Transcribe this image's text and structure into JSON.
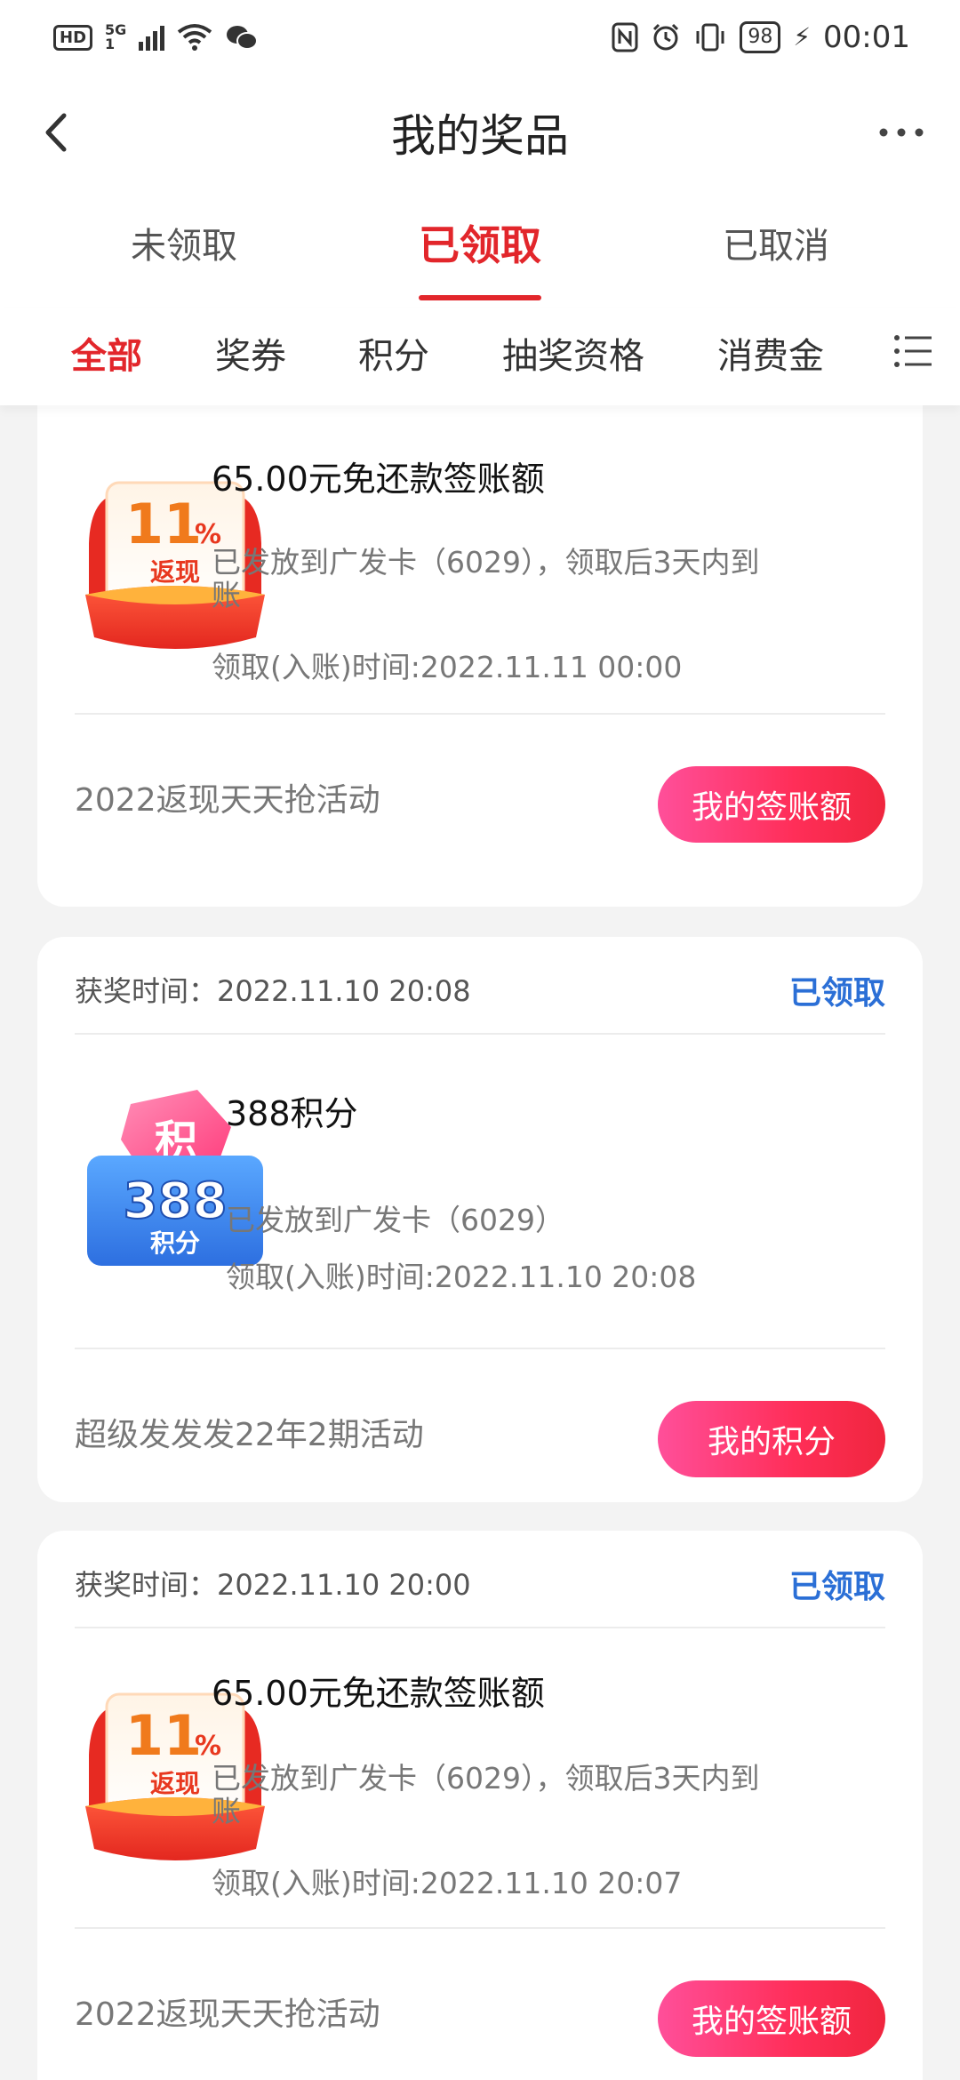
{
  "status_bar": {
    "hd": "HD",
    "network": "5G",
    "sub": "1",
    "battery": "98",
    "time": "00:01"
  },
  "nav": {
    "title": "我的奖品"
  },
  "tabs": [
    "未领取",
    "已领取",
    "已取消"
  ],
  "active_tab": "已领取",
  "filters": [
    "全部",
    "奖券",
    "积分",
    "抽奖资格",
    "消费金"
  ],
  "active_filter": "全部",
  "colors": {
    "accent_red": "#e2262b",
    "status_blue": "#2b6fd6",
    "button_gradient_start": "#ff4f9a",
    "button_gradient_end": "#f0263e"
  },
  "cards": [
    {
      "won_label": "",
      "status": "",
      "image": {
        "icon": "cashback-11-percent-icon",
        "big": "11",
        "unit": "%",
        "sub": "返现"
      },
      "title": "65.00元免还款签账额",
      "desc": "已发放到广发卡（6029），领取后3天内到账",
      "time": "领取(入账)时间:2022.11.11 00:00",
      "activity": "2022返现天天抢活动",
      "button": "我的签账额"
    },
    {
      "won_label": "获奖时间：2022.11.10 20:08",
      "status": "已领取",
      "image": {
        "icon": "points-388-icon",
        "big": "388",
        "sub": "积分",
        "tag": "积"
      },
      "title": "388积分",
      "desc": "已发放到广发卡（6029）",
      "time": "领取(入账)时间:2022.11.10 20:08",
      "activity": "超级发发发22年2期活动",
      "button": "我的积分"
    },
    {
      "won_label": "获奖时间：2022.11.10 20:00",
      "status": "已领取",
      "image": {
        "icon": "cashback-11-percent-icon",
        "big": "11",
        "unit": "%",
        "sub": "返现"
      },
      "title": "65.00元免还款签账额",
      "desc": "已发放到广发卡（6029），领取后3天内到账",
      "time": "领取(入账)时间:2022.11.10 20:07",
      "activity": "2022返现天天抢活动",
      "button": "我的签账额"
    }
  ]
}
